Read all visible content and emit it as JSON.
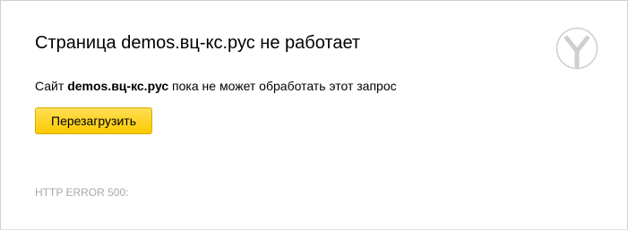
{
  "error_page": {
    "title": "Страница demos.вц-кс.рус не работает",
    "message": {
      "prefix": "Сайт ",
      "site": "demos.вц-кс.рус",
      "suffix": " пока не может обработать этот запрос"
    },
    "reload_button_label": "Перезагрузить",
    "error_code": "HTTP ERROR 500:"
  },
  "logo": {
    "icon": "yandex-browser-logo-icon"
  },
  "colors": {
    "button_fill": "#fcc900",
    "button_border": "#d8ad00",
    "error_code_text": "#a8a8a8",
    "logo_stroke": "#cfcfcf"
  }
}
